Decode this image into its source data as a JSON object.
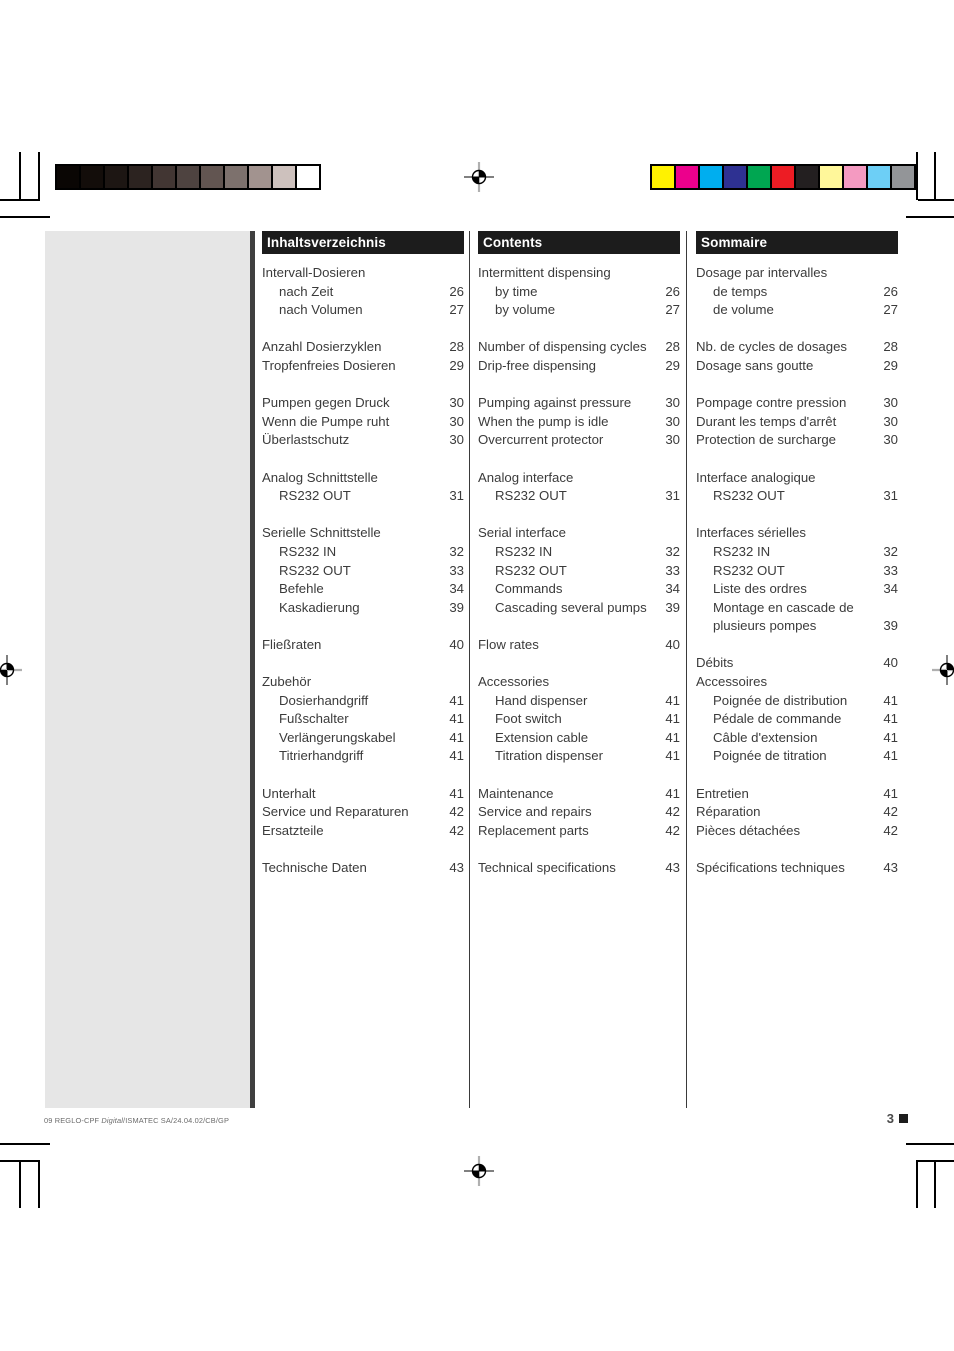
{
  "page": {
    "number": "3",
    "footer_note_prefix": "09 REGLO-CPF ",
    "footer_note_italic": "Digital",
    "footer_note_suffix": "/ISMATEC SA/24.04.02/CB/GP"
  },
  "calibration": {
    "grayscale_label": "grayscale-step-wedge",
    "grayscale_swatches": [
      "#0a0604",
      "#130d0a",
      "#1d1613",
      "#2c2320",
      "#423633",
      "#4e4340",
      "#625551",
      "#7d716d",
      "#a2938f",
      "#cdc1bd",
      "#ffffff"
    ],
    "color_label": "color-control-bar",
    "color_swatches": [
      "#fff200",
      "#ec008c",
      "#00aeef",
      "#2e3192",
      "#00a651",
      "#ed1c24",
      "#231f20",
      "#fff79a",
      "#f49ac1",
      "#6dcff6",
      "#939598"
    ]
  },
  "columns": [
    {
      "id": "de",
      "header": "Inhaltsverzeichnis",
      "entries": [
        {
          "label": "Intervall-Dosieren",
          "page": "",
          "indent": 0,
          "gap": false
        },
        {
          "label": "nach Zeit",
          "page": "26",
          "indent": 1,
          "gap": false
        },
        {
          "label": "nach Volumen",
          "page": "27",
          "indent": 1,
          "gap": false
        },
        {
          "label": "Anzahl Dosierzyklen",
          "page": "28",
          "indent": 0,
          "gap": true
        },
        {
          "label": "Tropfenfreies Dosieren",
          "page": "29",
          "indent": 0,
          "gap": false
        },
        {
          "label": "Pumpen gegen Druck",
          "page": "30",
          "indent": 0,
          "gap": true
        },
        {
          "label": "Wenn die Pumpe ruht",
          "page": "30",
          "indent": 0,
          "gap": false
        },
        {
          "label": "Überlastschutz",
          "page": "30",
          "indent": 0,
          "gap": false
        },
        {
          "label": "Analog Schnittstelle",
          "page": "",
          "indent": 0,
          "gap": true
        },
        {
          "label": "RS232 OUT",
          "page": "31",
          "indent": 1,
          "gap": false
        },
        {
          "label": "Serielle Schnittstelle",
          "page": "",
          "indent": 0,
          "gap": true
        },
        {
          "label": "RS232 IN",
          "page": "32",
          "indent": 1,
          "gap": false
        },
        {
          "label": "RS232 OUT",
          "page": "33",
          "indent": 1,
          "gap": false
        },
        {
          "label": "Befehle",
          "page": "34",
          "indent": 1,
          "gap": false
        },
        {
          "label": "Kaskadierung",
          "page": "39",
          "indent": 1,
          "gap": false
        },
        {
          "label": "Fließraten",
          "page": "40",
          "indent": 0,
          "gap": true
        },
        {
          "label": "Zubehör",
          "page": "",
          "indent": 0,
          "gap": true
        },
        {
          "label": "Dosierhandgriff",
          "page": "41",
          "indent": 1,
          "gap": false
        },
        {
          "label": "Fußschalter",
          "page": "41",
          "indent": 1,
          "gap": false
        },
        {
          "label": "Verlängerungskabel",
          "page": "41",
          "indent": 1,
          "gap": false
        },
        {
          "label": "Titrierhandgriff",
          "page": "41",
          "indent": 1,
          "gap": false
        },
        {
          "label": "Unterhalt",
          "page": "41",
          "indent": 0,
          "gap": true
        },
        {
          "label": "Service und Reparaturen",
          "page": "42",
          "indent": 0,
          "gap": false
        },
        {
          "label": "Ersatzteile",
          "page": "42",
          "indent": 0,
          "gap": false
        },
        {
          "label": "Technische Daten",
          "page": "43",
          "indent": 0,
          "gap": true
        }
      ]
    },
    {
      "id": "en",
      "header": "Contents",
      "entries": [
        {
          "label": "Intermittent dispensing",
          "page": "",
          "indent": 0,
          "gap": false
        },
        {
          "label": "by time",
          "page": "26",
          "indent": 1,
          "gap": false
        },
        {
          "label": "by volume",
          "page": "27",
          "indent": 1,
          "gap": false
        },
        {
          "label": "Number of dispensing cycles",
          "page": "28",
          "indent": 0,
          "gap": true
        },
        {
          "label": "Drip-free dispensing",
          "page": "29",
          "indent": 0,
          "gap": false
        },
        {
          "label": "Pumping against pressure",
          "page": "30",
          "indent": 0,
          "gap": true
        },
        {
          "label": "When the pump is idle",
          "page": "30",
          "indent": 0,
          "gap": false
        },
        {
          "label": "Overcurrent protector",
          "page": "30",
          "indent": 0,
          "gap": false
        },
        {
          "label": "Analog interface",
          "page": "",
          "indent": 0,
          "gap": true
        },
        {
          "label": "RS232 OUT",
          "page": "31",
          "indent": 1,
          "gap": false
        },
        {
          "label": "Serial interface",
          "page": "",
          "indent": 0,
          "gap": true
        },
        {
          "label": "RS232 IN",
          "page": "32",
          "indent": 1,
          "gap": false
        },
        {
          "label": "RS232 OUT",
          "page": "33",
          "indent": 1,
          "gap": false
        },
        {
          "label": "Commands",
          "page": "34",
          "indent": 1,
          "gap": false
        },
        {
          "label": "Cascading several pumps",
          "page": "39",
          "indent": 1,
          "gap": false
        },
        {
          "label": "Flow rates",
          "page": "40",
          "indent": 0,
          "gap": true
        },
        {
          "label": "Accessories",
          "page": "",
          "indent": 0,
          "gap": true
        },
        {
          "label": "Hand dispenser",
          "page": "41",
          "indent": 1,
          "gap": false
        },
        {
          "label": "Foot switch",
          "page": "41",
          "indent": 1,
          "gap": false
        },
        {
          "label": "Extension cable",
          "page": "41",
          "indent": 1,
          "gap": false
        },
        {
          "label": "Titration dispenser",
          "page": "41",
          "indent": 1,
          "gap": false
        },
        {
          "label": "Maintenance",
          "page": "41",
          "indent": 0,
          "gap": true
        },
        {
          "label": "Service and repairs",
          "page": "42",
          "indent": 0,
          "gap": false
        },
        {
          "label": "Replacement parts",
          "page": "42",
          "indent": 0,
          "gap": false
        },
        {
          "label": "Technical specifications",
          "page": "43",
          "indent": 0,
          "gap": true
        }
      ]
    },
    {
      "id": "fr",
      "header": "Sommaire",
      "entries": [
        {
          "label": "Dosage par intervalles",
          "page": "",
          "indent": 0,
          "gap": false
        },
        {
          "label": "de temps",
          "page": "26",
          "indent": 1,
          "gap": false
        },
        {
          "label": "de volume",
          "page": "27",
          "indent": 1,
          "gap": false
        },
        {
          "label": "Nb. de cycles de dosages",
          "page": "28",
          "indent": 0,
          "gap": true
        },
        {
          "label": "Dosage sans goutte",
          "page": "29",
          "indent": 0,
          "gap": false
        },
        {
          "label": "Pompage contre pression",
          "page": "30",
          "indent": 0,
          "gap": true
        },
        {
          "label": "Durant les temps d'arrêt",
          "page": "30",
          "indent": 0,
          "gap": false
        },
        {
          "label": "Protection de surcharge",
          "page": "30",
          "indent": 0,
          "gap": false
        },
        {
          "label": "Interface analogique",
          "page": "",
          "indent": 0,
          "gap": true
        },
        {
          "label": "RS232 OUT",
          "page": "31",
          "indent": 1,
          "gap": false
        },
        {
          "label": "Interfaces sérielles",
          "page": "",
          "indent": 0,
          "gap": true
        },
        {
          "label": "RS232 IN",
          "page": "32",
          "indent": 1,
          "gap": false
        },
        {
          "label": "RS232 OUT",
          "page": "33",
          "indent": 1,
          "gap": false
        },
        {
          "label": "Liste des ordres",
          "page": "34",
          "indent": 1,
          "gap": false
        },
        {
          "label": "Montage en cascade de",
          "page": "",
          "indent": 1,
          "gap": false
        },
        {
          "label": "plusieurs pompes",
          "page": "39",
          "indent": 1,
          "gap": false
        },
        {
          "label": "Débits",
          "page": "40",
          "indent": 0,
          "gap": true
        },
        {
          "label": "Accessoires",
          "page": "",
          "indent": 0,
          "gap": false
        },
        {
          "label": "Poignée de distribution",
          "page": "41",
          "indent": 1,
          "gap": false
        },
        {
          "label": "Pédale de commande",
          "page": "41",
          "indent": 1,
          "gap": false
        },
        {
          "label": "Câble d'extension",
          "page": "41",
          "indent": 1,
          "gap": false
        },
        {
          "label": "Poignée de titration",
          "page": "41",
          "indent": 1,
          "gap": false
        },
        {
          "label": "Entretien",
          "page": "41",
          "indent": 0,
          "gap": true
        },
        {
          "label": "Réparation",
          "page": "42",
          "indent": 0,
          "gap": false
        },
        {
          "label": "Pièces détachées",
          "page": "42",
          "indent": 0,
          "gap": false
        },
        {
          "label": "Spécifications techniques",
          "page": "43",
          "indent": 0,
          "gap": true
        }
      ]
    }
  ]
}
